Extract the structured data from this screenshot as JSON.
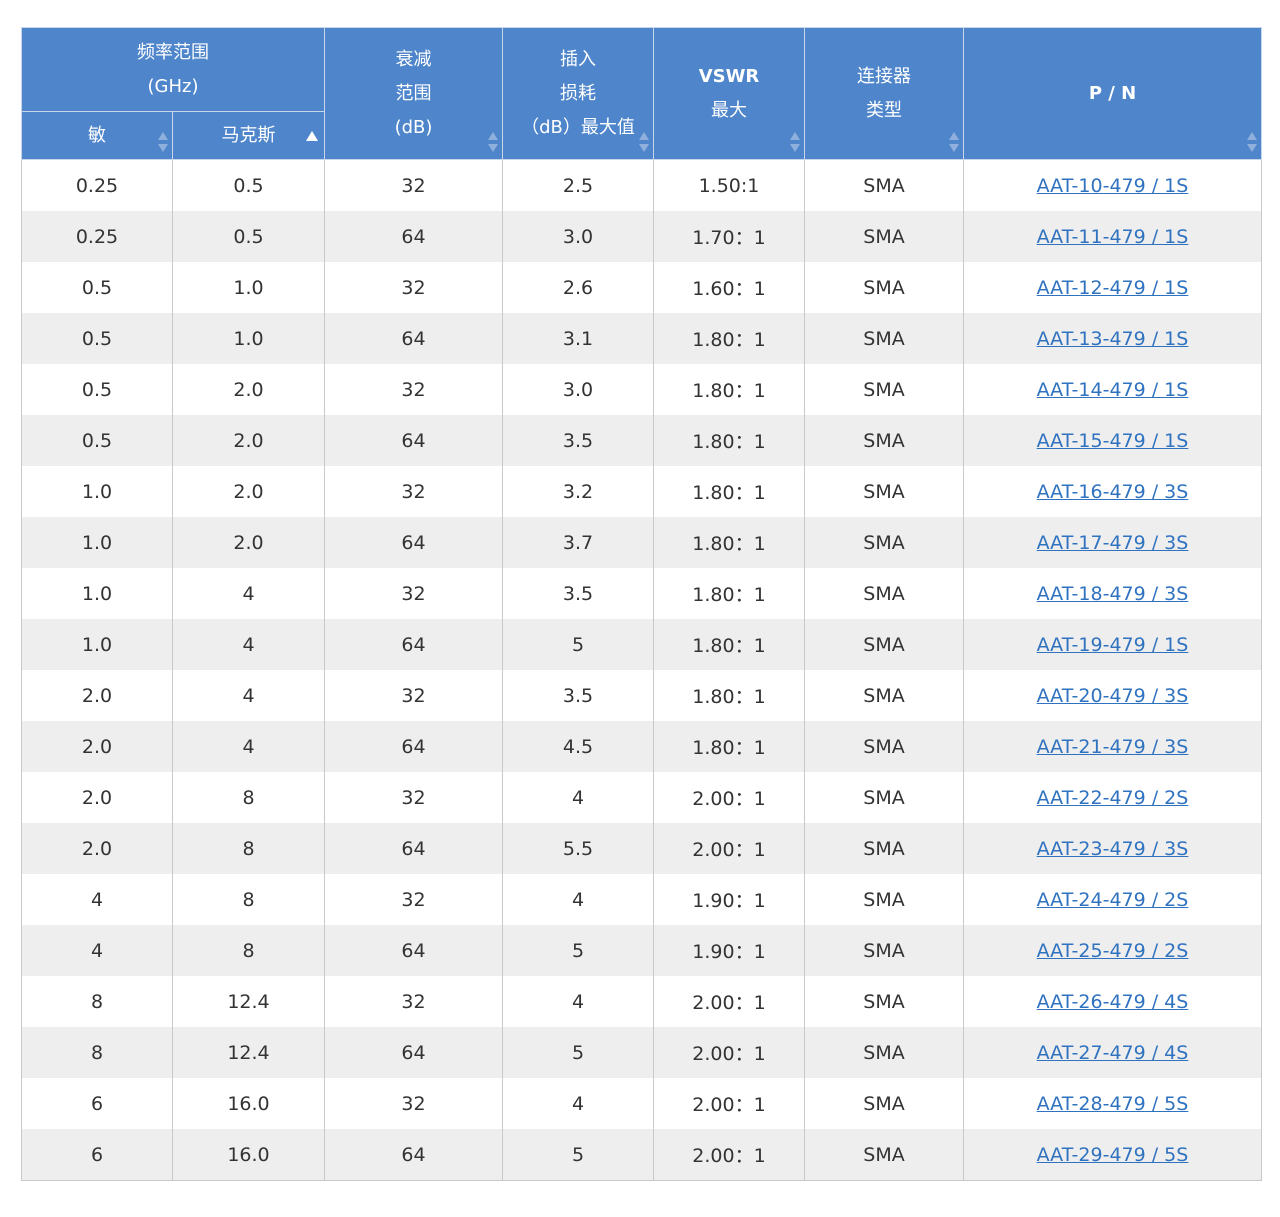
{
  "headers": {
    "freq_group": [
      "频率范围",
      "(GHz)"
    ],
    "min": "敏",
    "max": "马克斯",
    "atten": [
      "衰减",
      "范围",
      "(dB)"
    ],
    "insertion": [
      "插入",
      "损耗",
      "（dB）最大值"
    ],
    "vswr": [
      "VSWR",
      "最大"
    ],
    "connector": [
      "连接器",
      "类型"
    ],
    "pn": "P / N"
  },
  "rows": [
    {
      "min": "0.25",
      "max": "0.5",
      "atten": "32",
      "loss": "2.5",
      "vswr": "1.50:1",
      "conn": "SMA",
      "pn": "AAT-10-479 / 1S"
    },
    {
      "min": "0.25",
      "max": "0.5",
      "atten": "64",
      "loss": "3.0",
      "vswr": "1.70：1",
      "conn": "SMA",
      "pn": "AAT-11-479 / 1S"
    },
    {
      "min": "0.5",
      "max": "1.0",
      "atten": "32",
      "loss": "2.6",
      "vswr": "1.60：1",
      "conn": "SMA",
      "pn": "AAT-12-479 / 1S"
    },
    {
      "min": "0.5",
      "max": "1.0",
      "atten": "64",
      "loss": "3.1",
      "vswr": "1.80：1",
      "conn": "SMA",
      "pn": "AAT-13-479 / 1S"
    },
    {
      "min": "0.5",
      "max": "2.0",
      "atten": "32",
      "loss": "3.0",
      "vswr": "1.80：1",
      "conn": "SMA",
      "pn": "AAT-14-479 / 1S"
    },
    {
      "min": "0.5",
      "max": "2.0",
      "atten": "64",
      "loss": "3.5",
      "vswr": "1.80：1",
      "conn": "SMA",
      "pn": "AAT-15-479 / 1S"
    },
    {
      "min": "1.0",
      "max": "2.0",
      "atten": "32",
      "loss": "3.2",
      "vswr": "1.80：1",
      "conn": "SMA",
      "pn": "AAT-16-479 / 3S"
    },
    {
      "min": "1.0",
      "max": "2.0",
      "atten": "64",
      "loss": "3.7",
      "vswr": "1.80：1",
      "conn": "SMA",
      "pn": "AAT-17-479 / 3S"
    },
    {
      "min": "1.0",
      "max": "4",
      "atten": "32",
      "loss": "3.5",
      "vswr": "1.80：1",
      "conn": "SMA",
      "pn": "AAT-18-479 / 3S"
    },
    {
      "min": "1.0",
      "max": "4",
      "atten": "64",
      "loss": "5",
      "vswr": "1.80：1",
      "conn": "SMA",
      "pn": "AAT-19-479 / 1S"
    },
    {
      "min": "2.0",
      "max": "4",
      "atten": "32",
      "loss": "3.5",
      "vswr": "1.80：1",
      "conn": "SMA",
      "pn": "AAT-20-479 / 3S"
    },
    {
      "min": "2.0",
      "max": "4",
      "atten": "64",
      "loss": "4.5",
      "vswr": "1.80：1",
      "conn": "SMA",
      "pn": "AAT-21-479 / 3S"
    },
    {
      "min": "2.0",
      "max": "8",
      "atten": "32",
      "loss": "4",
      "vswr": "2.00：1",
      "conn": "SMA",
      "pn": "AAT-22-479 / 2S"
    },
    {
      "min": "2.0",
      "max": "8",
      "atten": "64",
      "loss": "5.5",
      "vswr": "2.00：1",
      "conn": "SMA",
      "pn": "AAT-23-479 / 3S"
    },
    {
      "min": "4",
      "max": "8",
      "atten": "32",
      "loss": "4",
      "vswr": "1.90：1",
      "conn": "SMA",
      "pn": "AAT-24-479 / 2S"
    },
    {
      "min": "4",
      "max": "8",
      "atten": "64",
      "loss": "5",
      "vswr": "1.90：1",
      "conn": "SMA",
      "pn": "AAT-25-479 / 2S"
    },
    {
      "min": "8",
      "max": "12.4",
      "atten": "32",
      "loss": "4",
      "vswr": "2.00：1",
      "conn": "SMA",
      "pn": "AAT-26-479 / 4S"
    },
    {
      "min": "8",
      "max": "12.4",
      "atten": "64",
      "loss": "5",
      "vswr": "2.00：1",
      "conn": "SMA",
      "pn": "AAT-27-479 / 4S"
    },
    {
      "min": "6",
      "max": "16.0",
      "atten": "32",
      "loss": "4",
      "vswr": "2.00：1",
      "conn": "SMA",
      "pn": "AAT-28-479 / 5S"
    },
    {
      "min": "6",
      "max": "16.0",
      "atten": "64",
      "loss": "5",
      "vswr": "2.00：1",
      "conn": "SMA",
      "pn": "AAT-29-479 / 5S"
    }
  ],
  "colors": {
    "header_bg": "#4f86cb",
    "row_alt_bg": "#eeeeee",
    "link": "#2f72bf"
  }
}
